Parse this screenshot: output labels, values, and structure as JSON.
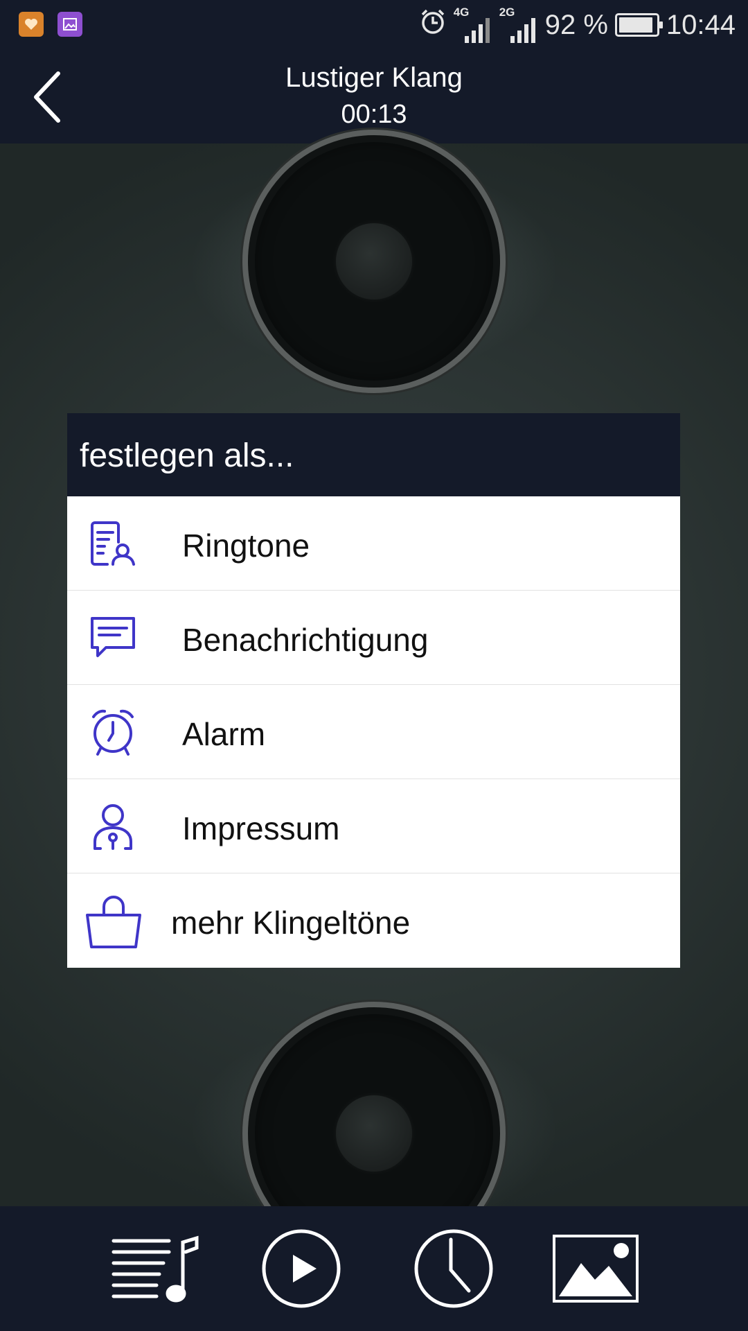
{
  "status_bar": {
    "network_4g": "4G",
    "network_2g": "2G",
    "battery_percent": "92 %",
    "battery_level": 0.92,
    "clock": "10:44",
    "icons": [
      "health-app-icon",
      "gallery-app-icon",
      "alarm-icon",
      "signal-icon",
      "signal-icon",
      "battery-icon"
    ]
  },
  "header": {
    "title": "Lustiger Klang",
    "duration": "00:13",
    "back_icon": "chevron-left-icon"
  },
  "dialog": {
    "title": "festlegen als...",
    "items": [
      {
        "label": "Ringtone",
        "icon": "contact-card-icon"
      },
      {
        "label": "Benachrichtigung",
        "icon": "message-icon"
      },
      {
        "label": "Alarm",
        "icon": "alarm-clock-icon"
      },
      {
        "label": "Impressum",
        "icon": "person-icon"
      },
      {
        "label": "mehr Klingeltöne",
        "icon": "shopping-bag-icon"
      }
    ],
    "accent_color": "#3f35c8"
  },
  "bottom_bar": {
    "icons": [
      "playlist-icon",
      "play-icon",
      "clock-icon",
      "image-icon"
    ]
  }
}
